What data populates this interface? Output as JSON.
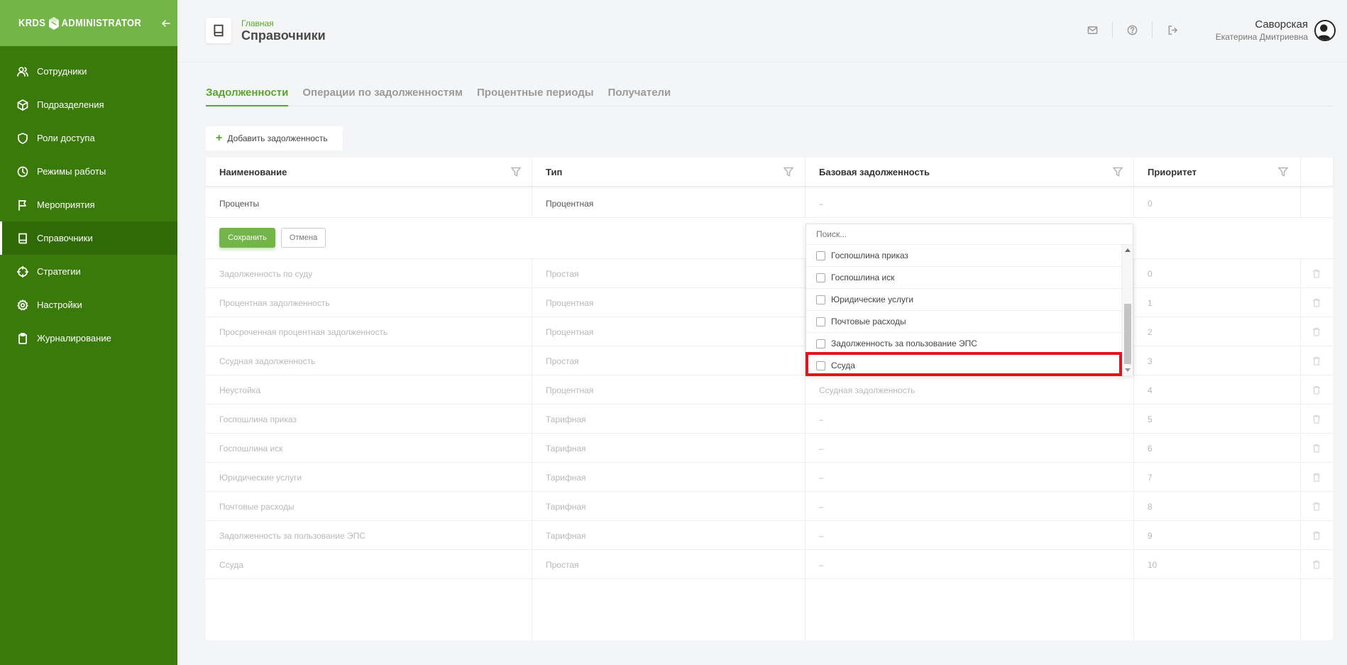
{
  "sidebar": {
    "logo_left": "KRDS",
    "logo_right": "ADMINISTRATOR",
    "items": [
      {
        "label": "Сотрудники"
      },
      {
        "label": "Подразделения"
      },
      {
        "label": "Роли доступа"
      },
      {
        "label": "Режимы работы"
      },
      {
        "label": "Мероприятия"
      },
      {
        "label": "Справочники",
        "active": true
      },
      {
        "label": "Стратегии"
      },
      {
        "label": "Настройки"
      },
      {
        "label": "Журналирование"
      }
    ]
  },
  "header": {
    "breadcrumb": "Главная",
    "title": "Справочники",
    "user_last_name": "Саворская",
    "user_first_names": "Екатерина Дмитриевна"
  },
  "tabs": [
    {
      "label": "Задолженности",
      "active": true
    },
    {
      "label": "Операции по задолженностям"
    },
    {
      "label": "Процентные периоды"
    },
    {
      "label": "Получатели"
    }
  ],
  "toolbar": {
    "add_label": "Добавить задолженность"
  },
  "table": {
    "columns": [
      "Наименование",
      "Тип",
      "Базовая задолженность",
      "Приоритет"
    ],
    "editing_row": {
      "name": "Проценты",
      "type": "Процентная",
      "base": "–",
      "priority": "0"
    },
    "save_label": "Сохранить",
    "cancel_label": "Отмена",
    "rows": [
      {
        "name": "Задолженность по суду",
        "type": "Простая",
        "base": "",
        "priority": "0"
      },
      {
        "name": "Процентная задолженность",
        "type": "Процентная",
        "base": "",
        "priority": "1"
      },
      {
        "name": "Просроченная процентная задолженность",
        "type": "Процентная",
        "base": "",
        "priority": "2"
      },
      {
        "name": "Ссудная задолженность",
        "type": "Простая",
        "base": "",
        "priority": "3"
      },
      {
        "name": "Неустойка",
        "type": "Процентная",
        "base": "Ссудная задолженность",
        "priority": "4"
      },
      {
        "name": "Госпошлина приказ",
        "type": "Тарифная",
        "base": "–",
        "priority": "5"
      },
      {
        "name": "Госпошлина иск",
        "type": "Тарифная",
        "base": "–",
        "priority": "6"
      },
      {
        "name": "Юридические услуги",
        "type": "Тарифная",
        "base": "–",
        "priority": "7"
      },
      {
        "name": "Почтовые расходы",
        "type": "Тарифная",
        "base": "–",
        "priority": "8"
      },
      {
        "name": "Задолженность за пользование ЭПС",
        "type": "Тарифная",
        "base": "–",
        "priority": "9"
      },
      {
        "name": "Ссуда",
        "type": "Простая",
        "base": "–",
        "priority": "10"
      }
    ]
  },
  "dropdown": {
    "search_placeholder": "Поиск...",
    "options": [
      {
        "label": "Госпошлина приказ"
      },
      {
        "label": "Госпошлина иск"
      },
      {
        "label": "Юридические услуги"
      },
      {
        "label": "Почтовые расходы"
      },
      {
        "label": "Задолженность за пользование ЭПС"
      },
      {
        "label": "Ссуда",
        "highlighted": true
      }
    ]
  },
  "colors": {
    "brand_green": "#3a7a0b",
    "logo_green": "#73b548",
    "accent_green": "#5aa52b",
    "highlight_red": "#e3141c"
  }
}
